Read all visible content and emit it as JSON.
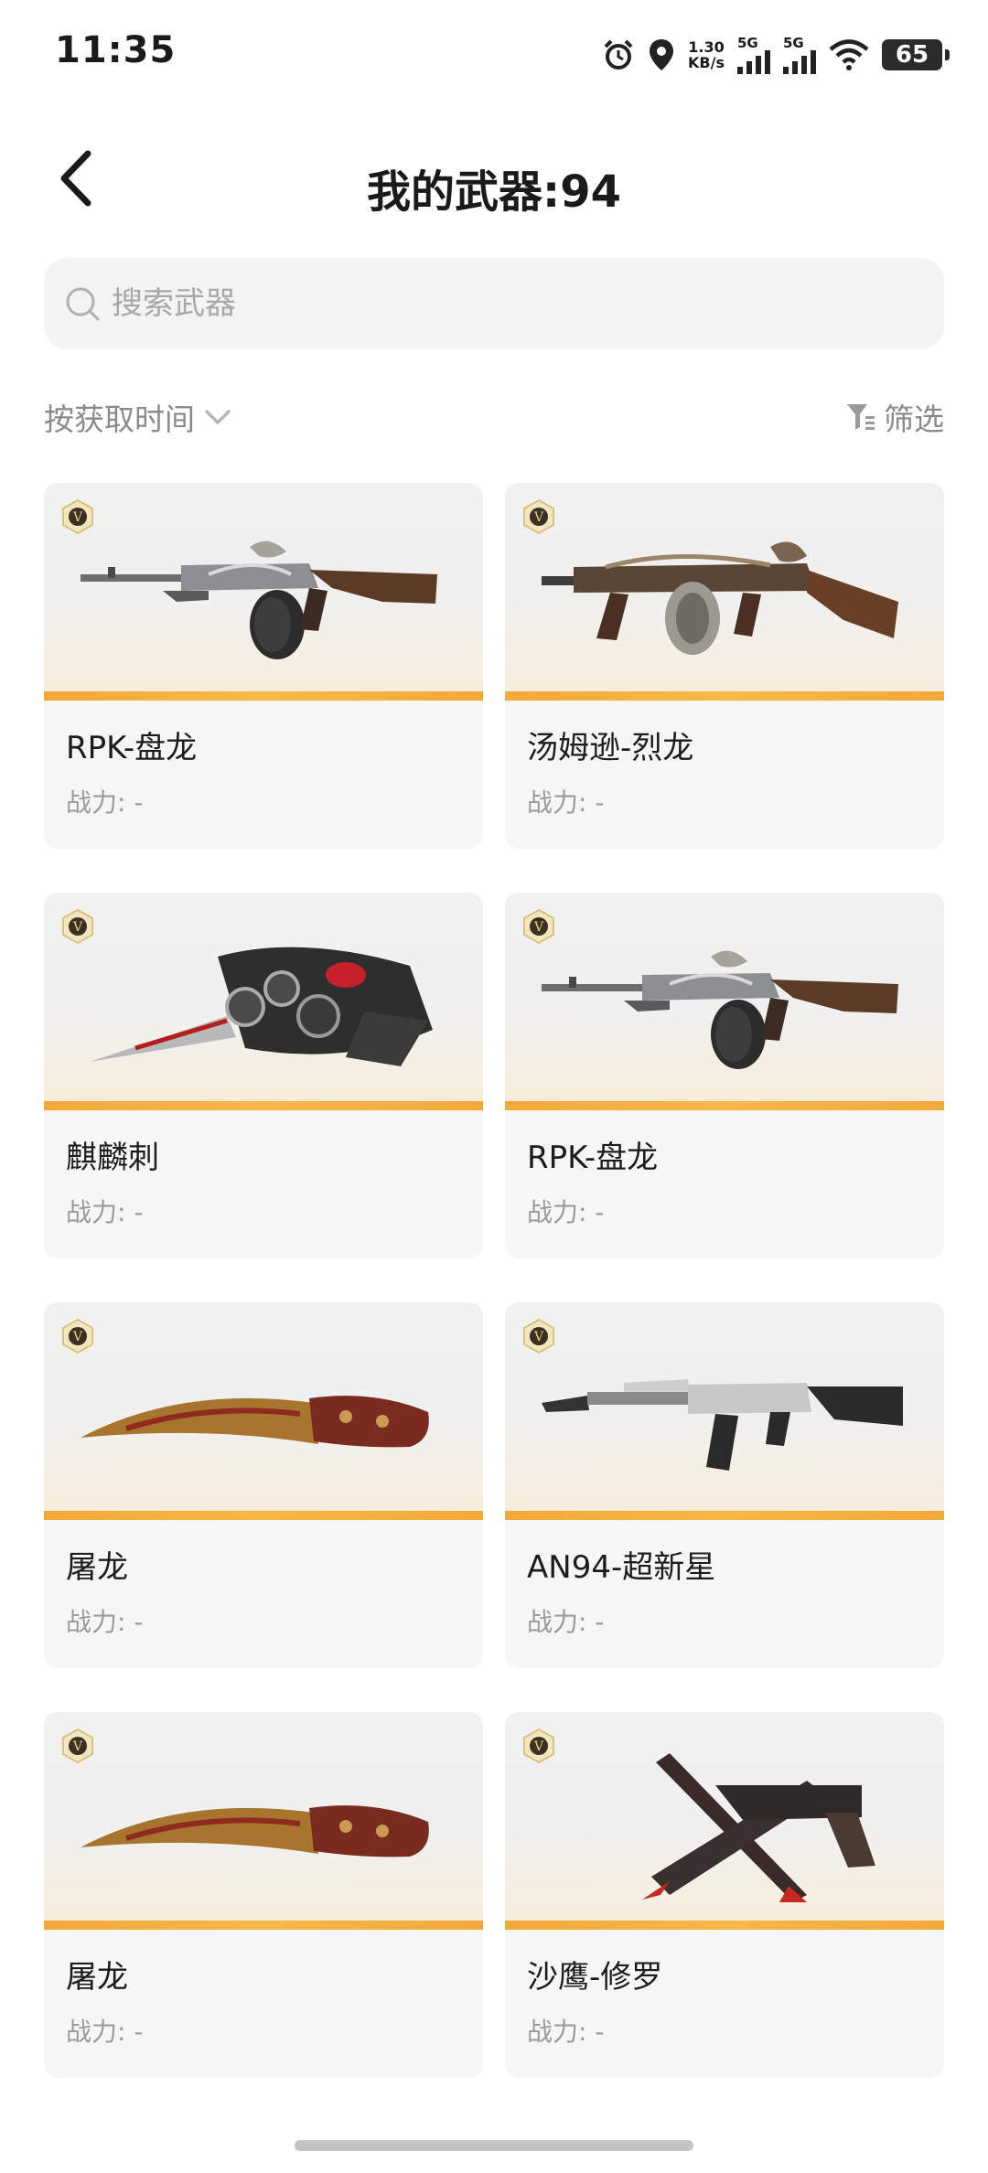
{
  "status_bar": {
    "time": "11:35",
    "net_speed_value": "1.30",
    "net_speed_unit": "KB/s",
    "sim1_label": "5G",
    "sim2_label": "5G",
    "battery": "65"
  },
  "header": {
    "title": "我的武器:94"
  },
  "search": {
    "placeholder": "搜索武器"
  },
  "toolbar": {
    "sort_label": "按获取时间",
    "filter_label": "筛选"
  },
  "weapons": [
    {
      "name": "RPK-盘龙",
      "power": "战力: -",
      "icon": "rifle-icon"
    },
    {
      "name": "汤姆逊-烈龙",
      "power": "战力: -",
      "icon": "smg-icon"
    },
    {
      "name": "麒麟刺",
      "power": "战力: -",
      "icon": "knuckle-blade-icon"
    },
    {
      "name": "RPK-盘龙",
      "power": "战力: -",
      "icon": "rifle-icon"
    },
    {
      "name": "屠龙",
      "power": "战力: -",
      "icon": "kukri-knife-icon"
    },
    {
      "name": "AN94-超新星",
      "power": "战力: -",
      "icon": "assault-rifle-icon"
    },
    {
      "name": "屠龙",
      "power": "战力: -",
      "icon": "kukri-knife-icon"
    },
    {
      "name": "沙鹰-修罗",
      "power": "战力: -",
      "icon": "pistol-knife-icon"
    }
  ],
  "colors": {
    "accent_stripe": "#f3a93a",
    "card_bg": "#f6f6f6",
    "muted_text": "#9a9a9a"
  }
}
